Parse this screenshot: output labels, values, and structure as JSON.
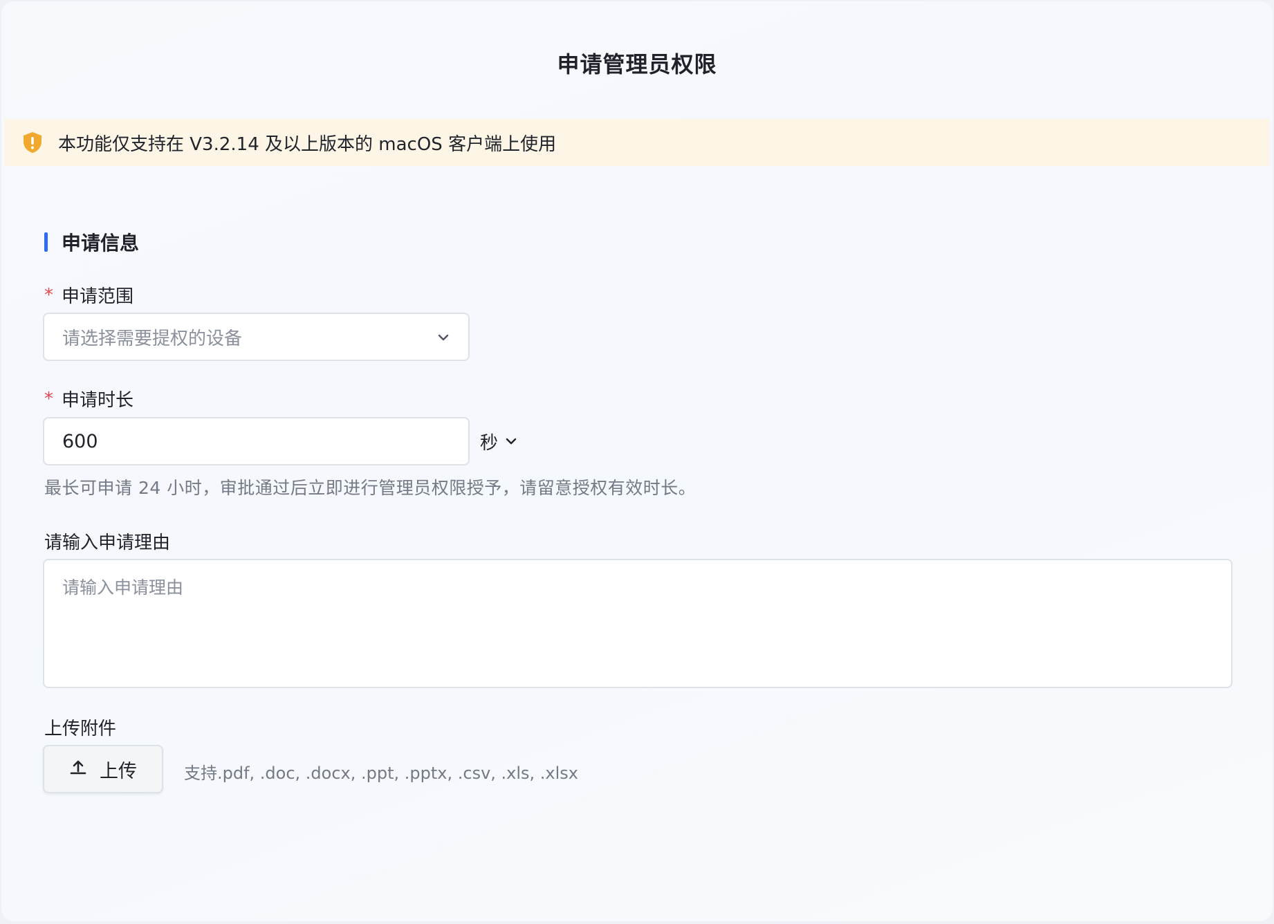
{
  "dialog": {
    "title": "申请管理员权限"
  },
  "notice": {
    "icon": "shield-warning-icon",
    "text": "本功能仅支持在 V3.2.14 及以上版本的 macOS 客户端上使用",
    "background": "#fdf5e6",
    "icon_color": "#f0a92c"
  },
  "section": {
    "title": "申请信息",
    "accent": "#2f6bf0"
  },
  "scope": {
    "required_mark": "*",
    "label": "申请范围",
    "placeholder": "请选择需要提权的设备",
    "icon": "chevron-down-icon"
  },
  "duration": {
    "required_mark": "*",
    "label": "申请时长",
    "value": "600",
    "unit": "秒",
    "unit_icon": "chevron-down-icon",
    "hint": "最长可申请 24 小时，审批通过后立即进行管理员权限授予，请留意授权有效时长。"
  },
  "reason": {
    "label": "请输入申请理由",
    "placeholder": "请输入申请理由"
  },
  "attachment": {
    "label": "上传附件",
    "button_label": "上传",
    "button_icon": "upload-icon",
    "formats_hint": "支持.pdf, .doc, .docx, .ppt, .pptx, .csv, .xls, .xlsx"
  }
}
